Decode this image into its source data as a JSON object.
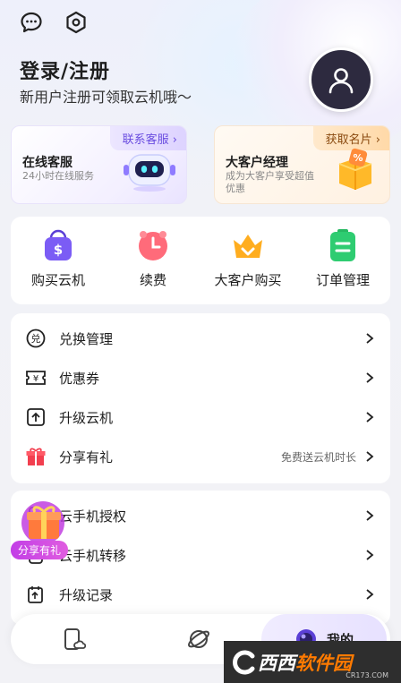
{
  "header": {
    "title": "登录/注册",
    "subtitle": "新用户注册可领取云机哦～"
  },
  "cards": [
    {
      "tag": "联系客服",
      "title": "在线客服",
      "desc": "24小时在线服务"
    },
    {
      "tag": "获取名片",
      "title": "大客户经理",
      "desc": "成为大客户享受超值优惠"
    }
  ],
  "quick_actions": [
    {
      "label": "购买云机",
      "icon": "purchase-bag-icon",
      "color": "#7b5cf5"
    },
    {
      "label": "续费",
      "icon": "clock-icon",
      "color": "#ff6b7a"
    },
    {
      "label": "大客户购买",
      "icon": "crown-icon",
      "color": "#ffad1f"
    },
    {
      "label": "订单管理",
      "icon": "order-list-icon",
      "color": "#2ecc71"
    }
  ],
  "menu1": [
    {
      "label": "兑换管理",
      "icon": "exchange-icon",
      "extra": ""
    },
    {
      "label": "优惠券",
      "icon": "coupon-icon",
      "extra": ""
    },
    {
      "label": "升级云机",
      "icon": "upgrade-icon",
      "extra": ""
    },
    {
      "label": "分享有礼",
      "icon": "gift-icon",
      "extra": "免费送云机时长"
    }
  ],
  "menu2": [
    {
      "label": "云手机授权",
      "icon": "authorize-icon"
    },
    {
      "label": "云手机转移",
      "icon": "transfer-icon"
    },
    {
      "label": "升级记录",
      "icon": "record-icon"
    }
  ],
  "floating_gift": {
    "label": "分享有礼"
  },
  "tabbar": {
    "tabs": [
      {
        "label": "",
        "icon": "cloud-phone-icon"
      },
      {
        "label": "",
        "icon": "planet-icon"
      },
      {
        "label": "我的",
        "icon": "profile-orb-icon"
      }
    ]
  },
  "watermark": {
    "text_white": "西西",
    "text_orange": "软件园",
    "sub": "CR173.COM"
  }
}
